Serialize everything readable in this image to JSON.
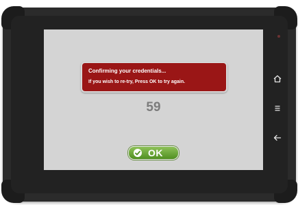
{
  "dialog": {
    "title": "Confirming your credentials...",
    "message": "If you wish to re-try, Press OK to try again."
  },
  "countdown": "59",
  "ok_button": {
    "label": "OK",
    "icon": "check-circle-icon"
  },
  "nav_buttons": [
    {
      "icon": "home-icon"
    },
    {
      "icon": "menu-icon"
    },
    {
      "icon": "back-icon"
    }
  ],
  "colors": {
    "dialog_background": "#9a1616",
    "screen_background": "#d4d4d4",
    "ok_button": "#6aa83a",
    "device_body": "#2b2b2b"
  }
}
